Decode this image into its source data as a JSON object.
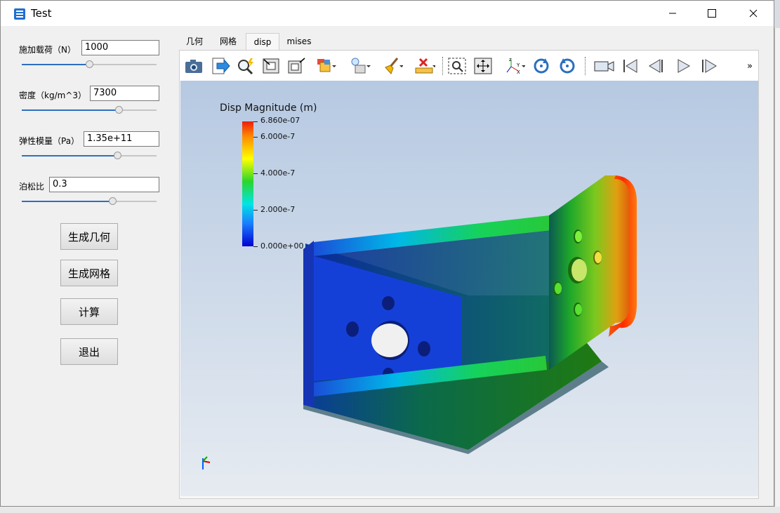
{
  "window": {
    "title": "Test",
    "minimize": "—",
    "maximize": "☐",
    "close": "✕"
  },
  "params": [
    {
      "label": "施加载荷（N）",
      "value": "1000",
      "slider": 0.5
    },
    {
      "label": "密度（kg/m^3）",
      "value": "7300",
      "slider": 0.72
    },
    {
      "label": "弹性模量（Pa）",
      "value": "1.35e+11",
      "slider": 0.71
    },
    {
      "label": "泊松比",
      "value": "0.3",
      "slider": 0.67
    }
  ],
  "buttons": {
    "geometry": "生成几何",
    "mesh": "生成网格",
    "compute": "计算",
    "exit": "退出"
  },
  "tabs": [
    "几何",
    "网格",
    "disp",
    "mises"
  ],
  "active_tab": "disp",
  "toolbar": {
    "more": "»"
  },
  "legend": {
    "title": "Disp Magnitude (m)",
    "ticks": [
      "6.860e-07",
      "6.000e-7",
      "4.000e-7",
      "2.000e-7",
      "0.000e+00"
    ]
  },
  "colors": {
    "accent": "#2f6fbf",
    "window_bg": "#f0f0f0"
  }
}
